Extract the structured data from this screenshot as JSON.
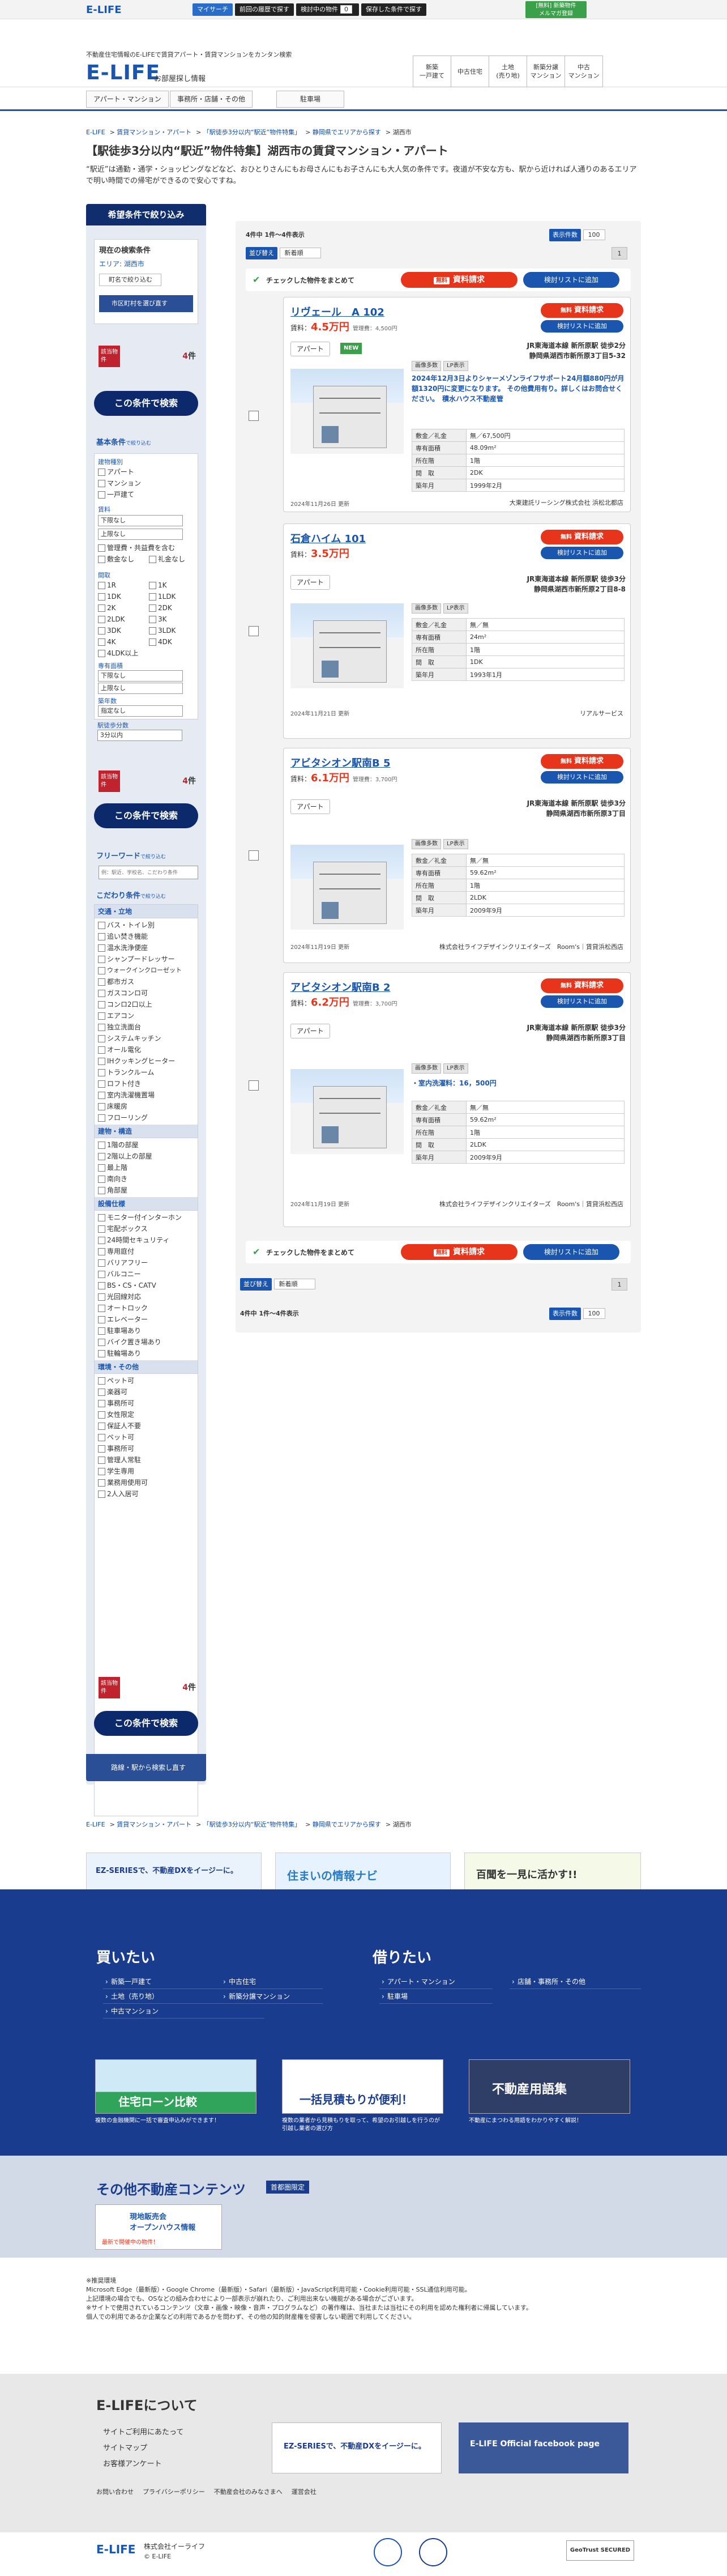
{
  "topbar": {
    "logo": "E-LIFE",
    "mypage": "マイサーチ",
    "history": "前回の履歴で探す",
    "viewed": "検討中の物件",
    "viewed_count": "0",
    "saved": "保存した条件で探す",
    "new_button_1": "新築物件",
    "new_button_2": "メルマガ登録",
    "new_button_prefix": "[無料]"
  },
  "header": {
    "tagline": "不動産住宅情報のE-LIFEで賃貸アパート・賃貸マンションをカンタン検索",
    "logo": "E-LIFE",
    "logo_sub": "お部屋探し情報",
    "cats": [
      "新築\n一戸建て",
      "中古住宅",
      "土地\n(売り地)",
      "新築分譲\nマンション",
      "中古\nマンション"
    ]
  },
  "subnav": [
    "アパート・マンション",
    "事務所・店舗・その他",
    "駐車場"
  ],
  "breadcrumb": [
    "E-LIFE",
    "賃貸マンション・アパート",
    "「駅徒歩3分以内“駅近”物件特集」",
    "静岡県でエリアから探す",
    "湖西市"
  ],
  "page": {
    "title": "【駅徒歩3分以内“駅近”物件特集】湖西市の賃貸マンション・アパート",
    "desc": "“駅近”は通勤・通学・ショッピングなどなど、おひとりさんにもお母さんにもお子さんにも大人気の条件です。夜道が不安な方も、駅から近ければ人通りのあるエリアで明い時間での帰宅ができるので安心ですね。"
  },
  "sidebar": {
    "head": "希望条件で絞り込み",
    "current": "現在の検索条件",
    "area": "エリア: 湖西市",
    "area_btn": "町名で絞り込む",
    "line_btn": "市区町村を選び直す",
    "match_label": "該当物件",
    "match_num": "4",
    "match_unit": "件",
    "cond_btn": "この条件で検索",
    "basic": "基本条件",
    "narrow": "で絞り込む",
    "types_label": "建物種別",
    "types": [
      "アパート",
      "マンション",
      "一戸建て"
    ],
    "rent_label": "賃料",
    "rent_min": "下限なし",
    "rent_max": "上限なし",
    "rent_opts": [
      "管理費・共益費を含む",
      "敷金なし",
      "礼金なし"
    ],
    "layout_label": "間取",
    "layouts": [
      "1R",
      "1K",
      "1DK",
      "1LDK",
      "2K",
      "2DK",
      "2LDK",
      "3K",
      "3DK",
      "3LDK",
      "4K",
      "4DK",
      "4LDK以上"
    ],
    "area_label": "専有面積",
    "area_min": "下限なし",
    "area_max": "上限なし",
    "age_label": "築年数",
    "age_val": "指定なし",
    "walk_label": "駅徒歩分数",
    "walk_val": "3分以内",
    "fw_label": "フリーワード",
    "fw_placeholder": "例：駅近、学校名、こだわり条件",
    "kodawari": "こだわり条件",
    "sec1": "交通・立地",
    "sec1_items": [
      "バス・トイレ別",
      "追い焚き機能",
      "温水洗浄便座",
      "シャンプードレッサー",
      "ウォークインクローゼット",
      "都市ガス",
      "ガスコンロ可",
      "コンロ2口以上",
      "エアコン",
      "独立洗面台",
      "システムキッチン",
      "オール電化",
      "IHクッキングヒーター",
      "トランクルーム",
      "ロフト付き",
      "室内洗濯機置場",
      "床暖房",
      "フローリング"
    ],
    "sec2": "建物・構造",
    "sec2_items": [
      "1階の部屋",
      "2階以上の部屋",
      "最上階",
      "南向き",
      "角部屋"
    ],
    "sec3": "設備仕様",
    "sec3_items": [
      "モニター付インターホン",
      "宅配ボックス",
      "24時間セキュリティ",
      "専用庭付",
      "バリアフリー",
      "バルコニー",
      "BS・CS・CATV",
      "光回線対応",
      "オートロック",
      "エレベーター",
      "駐車場あり",
      "バイク置き場あり",
      "駐輪場あり"
    ],
    "sec4": "環境・その他",
    "sec4_items": [
      "ペット可",
      "楽器可",
      "事務所可",
      "女性限定",
      "保証人不要",
      "ペット可",
      "事務所可",
      "管理人常駐",
      "学生専用",
      "業務用使用可",
      "2人入居可"
    ],
    "route_btn": "路線・駅から検索し直す"
  },
  "results": {
    "count_text": "4件中 1件～4件表示",
    "per_page_label": "表示件数",
    "per_page_val": "100",
    "sort_label": "並び替え",
    "sort_val": "新着順",
    "page": "1",
    "checked_text": "チェックした物件をまとめて",
    "request_prefix": "無料",
    "request_btn": "資料請求",
    "compare_btn": "検討リストに追加",
    "listings": [
      {
        "name": "リヴェール　A 102",
        "rent": "4.5万円",
        "fee": "管理費：4,500円",
        "type": "アパート",
        "new": "NEW",
        "station": "JR東海道本線 新所原駅 徒歩2分",
        "addr": "静岡県湖西市新所原3丁目5-32",
        "tags": [
          "画像多数",
          "LP表示"
        ],
        "note": "2024年12月3日よりシャーメゾンライフサポート24月額880円が月額1320円に変更になります。 その他費用有り。詳しくはお問合せください。　積水ハウス不動産管",
        "spec": [
          [
            "敷金／礼金",
            "無／67,500円"
          ],
          [
            "専有面積",
            "48.09m²"
          ],
          [
            "所在階",
            "1階"
          ],
          [
            "間　取",
            "2DK"
          ],
          [
            "築年月",
            "1999年2月"
          ]
        ],
        "updated": "2024年11月26日 更新",
        "company": "大東建託リーシング株式会社 浜松北都店"
      },
      {
        "name": "石倉ハイム 101",
        "rent": "3.5万円",
        "fee": "",
        "type": "アパート",
        "new": "",
        "station": "JR東海道本線 新所原駅 徒歩3分",
        "addr": "静岡県湖西市新所原2丁目8-8",
        "tags": [
          "画像多数",
          "LP表示"
        ],
        "note": "",
        "spec": [
          [
            "敷金／礼金",
            "無／無"
          ],
          [
            "専有面積",
            "24m²"
          ],
          [
            "所在階",
            "1階"
          ],
          [
            "間　取",
            "1DK"
          ],
          [
            "築年月",
            "1993年1月"
          ]
        ],
        "updated": "2024年11月21日 更新",
        "company": "リアルサービス"
      },
      {
        "name": "アビタシオン駅南B 5",
        "rent": "6.1万円",
        "fee": "管理費：3,700円",
        "type": "アパート",
        "new": "",
        "station": "JR東海道本線 新所原駅 徒歩3分",
        "addr": "静岡県湖西市新所原3丁目",
        "tags": [
          "画像多数",
          "LP表示"
        ],
        "note": "",
        "spec": [
          [
            "敷金／礼金",
            "無／無"
          ],
          [
            "専有面積",
            "59.62m²"
          ],
          [
            "所在階",
            "1階"
          ],
          [
            "間　取",
            "2LDK"
          ],
          [
            "築年月",
            "2009年9月"
          ]
        ],
        "updated": "2024年11月19日 更新",
        "company": "株式会社ライフデザインクリエイターズ　Room's｜賃貸浜松西店"
      },
      {
        "name": "アビタシオン駅南B 2",
        "rent": "6.2万円",
        "fee": "管理費：3,700円",
        "type": "アパート",
        "new": "",
        "station": "JR東海道本線 新所原駅 徒歩3分",
        "addr": "静岡県湖西市新所原3丁目",
        "tags": [
          "画像多数",
          "LP表示"
        ],
        "note": "・室内洗濯料：16，500円",
        "spec": [
          [
            "敷金／礼金",
            "無／無"
          ],
          [
            "専有面積",
            "59.62m²"
          ],
          [
            "所在階",
            "1階"
          ],
          [
            "間　取",
            "2LDK"
          ],
          [
            "築年月",
            "2009年9月"
          ]
        ],
        "updated": "2024年11月19日 更新",
        "company": "株式会社ライフデザインクリエイターズ　Room's｜賃貸浜松西店"
      }
    ]
  },
  "banners": [
    "EZ-SERIESで、不動産DXをイージーに。",
    "住まいの情報ナビ",
    "百聞を一見に活かす!!"
  ],
  "footer": {
    "buy_title": "買いたい",
    "buy_col1": [
      "新築一戸建て",
      "土地（売り地）",
      "中古マンション"
    ],
    "buy_col2": [
      "中古住宅",
      "新築分譲マンション"
    ],
    "rent_title": "借りたい",
    "rent_col1": [
      "アパート・マンション",
      "駐車場"
    ],
    "rent_col2": [
      "店舗・事務所・その他"
    ],
    "ban1": "住宅ローン比較",
    "ban1_cap": "複数の金融機関に一括で審査申込みができます！",
    "ban2": "一括見積もりが便利！",
    "ban2_cap": "複数の業者から見積もりを取って、希望のお引越しを行うのが引越し業者の選び方",
    "ban3": "不動産用語集",
    "ban3_cap": "不動産にまつわる用語をわかりやすく解説！"
  },
  "other": {
    "title": "その他不動産コンテンツ",
    "badge": "首都圏限定",
    "card_title": "現地販売会\nオープンハウス情報",
    "card_sub": "最新で開催中の物件！"
  },
  "disclaimer": "※推奨環境\nMicrosoft Edge（最新版）・Google Chrome（最新版）・Safari（最新版）・JavaScript利用可能・Cookie利用可能・SSL通信利用可能。\n上記環境の場合でも、OSなどの組み合わせにより一部表示が崩れたり、ご利用出来ない機能がある場合がございます。\n※サイトで使用されているコンテンツ（文章・画像・映像・音声・プログラムなど）の著作権は、当社または当社にその利用を認めた権利者に帰属しています。\n個人での利用であるか企業などの利用であるかを問わず、その他の知的財産権を侵害しない範囲で利用してください。",
  "about": {
    "title": "E-LIFEについて",
    "links": [
      "サイトご利用にあたって",
      "サイトマップ",
      "お客様アンケート"
    ],
    "ez": "EZ-SERIESで、不動産DXをイージーに。",
    "fb": "E-LIFE Official facebook page",
    "policy": [
      "お問い合わせ",
      "プライバシーポリシー",
      "不動産会社のみなさまへ",
      "運営会社"
    ]
  },
  "bottom": {
    "company": "株式会社イーライフ",
    "copy": "© E-LIFE",
    "geotrust": "GeoTrust SECURED"
  }
}
